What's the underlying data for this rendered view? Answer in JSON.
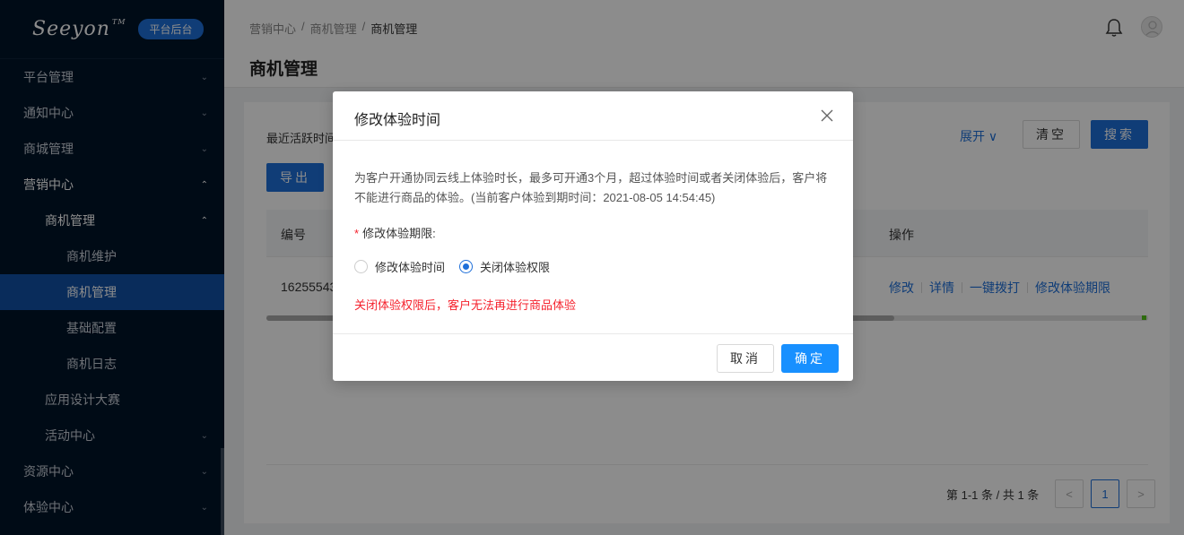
{
  "sidebar": {
    "logo": "Seeyon",
    "logo_tm": "TM",
    "badge": "平台后台",
    "items": [
      {
        "label": "平台管理",
        "chev": "⌄"
      },
      {
        "label": "通知中心",
        "chev": "⌄"
      },
      {
        "label": "商城管理",
        "chev": "⌄"
      },
      {
        "label": "营销中心",
        "chev": "⌃"
      },
      {
        "label": "商机管理",
        "chev": "⌃"
      },
      {
        "label": "商机维护"
      },
      {
        "label": "商机管理"
      },
      {
        "label": "基础配置"
      },
      {
        "label": "商机日志"
      },
      {
        "label": "应用设计大赛"
      },
      {
        "label": "活动中心",
        "chev": "⌄"
      },
      {
        "label": "资源中心",
        "chev": "⌄"
      },
      {
        "label": "体验中心",
        "chev": "⌄"
      }
    ]
  },
  "header": {
    "breadcrumb": [
      "营销中心",
      "/",
      "商机管理",
      "/",
      "商机管理"
    ],
    "title": "商机管理"
  },
  "filter": {
    "label": "最近活跃时间",
    "expand": "展开",
    "clear": "清空",
    "search": "搜索",
    "export": "导出"
  },
  "table": {
    "columns": [
      "编号",
      "操作"
    ],
    "rows": [
      {
        "id": "16255543",
        "actions": [
          "修改",
          "详情",
          "一键拨打",
          "修改体验期限"
        ]
      }
    ]
  },
  "pagination": {
    "total_text": "第 1-1 条 / 共 1 条",
    "current": "1",
    "prev": "<",
    "next": ">"
  },
  "modal": {
    "title": "修改体验时间",
    "description": "为客户开通协同云线上体验时长，最多可开通3个月，超过体验时间或者关闭体验后，客户将不能进行商品的体验。(当前客户体验到期时间：2021-08-05 14:54:45)",
    "field_label": "修改体验期限:",
    "required_mark": "*",
    "options": [
      {
        "label": "修改体验时间",
        "checked": false
      },
      {
        "label": "关闭体验权限",
        "checked": true
      }
    ],
    "warning": "关闭体验权限后，客户无法再进行商品体验",
    "cancel": "取消",
    "ok": "确定"
  },
  "colors": {
    "sidebar_bg": "#001529",
    "primary": "#1e6fd9",
    "danger": "#f5222d"
  }
}
